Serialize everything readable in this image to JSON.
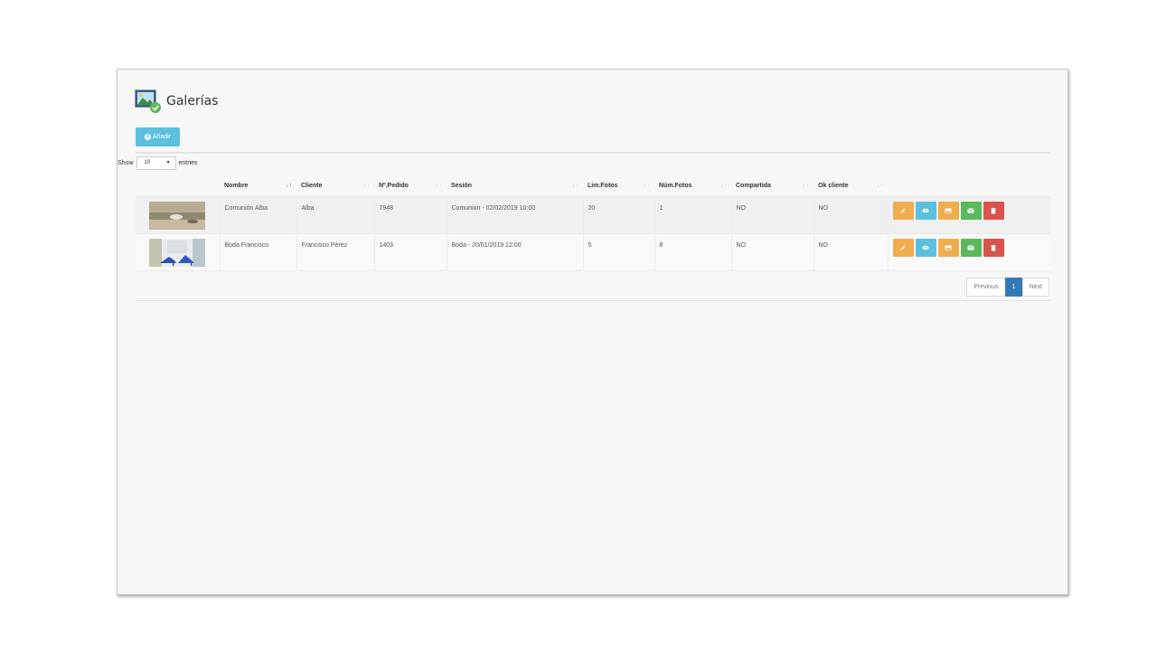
{
  "header": {
    "title": "Galerías",
    "icon": "gallery-image-check-icon"
  },
  "toolbar": {
    "add_label": "Añadir",
    "add_icon": "plus-circle-icon"
  },
  "length_control": {
    "show_label": "Show",
    "selected": "10",
    "entries_label": "entries"
  },
  "table": {
    "columns": [
      "",
      "Nombre",
      "Cliente",
      "Nº.Pedido",
      "Sesión",
      "Lim.Fotos",
      "Núm.Fotos",
      "Compartida",
      "Ok cliente",
      ""
    ],
    "rows": [
      {
        "thumb": "communion-photo",
        "nombre": "Comunión Alba",
        "cliente": "Alba",
        "pedido": "7948",
        "sesion": "Comunion - 02/02/2019 10:00",
        "lim_fotos": "20",
        "num_fotos": "1",
        "compartida": "NO",
        "ok_cliente": "NO"
      },
      {
        "thumb": "wedding-shoes-photo",
        "nombre": "Boda Francisco",
        "cliente": "Francisco Pérez",
        "pedido": "1403",
        "sesion": "Boda - 20/01/2019 12:00",
        "lim_fotos": "5",
        "num_fotos": "8",
        "compartida": "NO",
        "ok_cliente": "NO"
      }
    ],
    "row_actions": [
      "pencil-icon",
      "eye-icon",
      "image-icon",
      "envelope-icon",
      "trash-icon"
    ]
  },
  "pagination": {
    "previous": "Previous",
    "current": "1",
    "next": "Next"
  },
  "colors": {
    "info": "#5bc0de",
    "warning": "#f0ad4e",
    "success": "#5cb85c",
    "danger": "#d9534f",
    "primary": "#337ab7"
  }
}
